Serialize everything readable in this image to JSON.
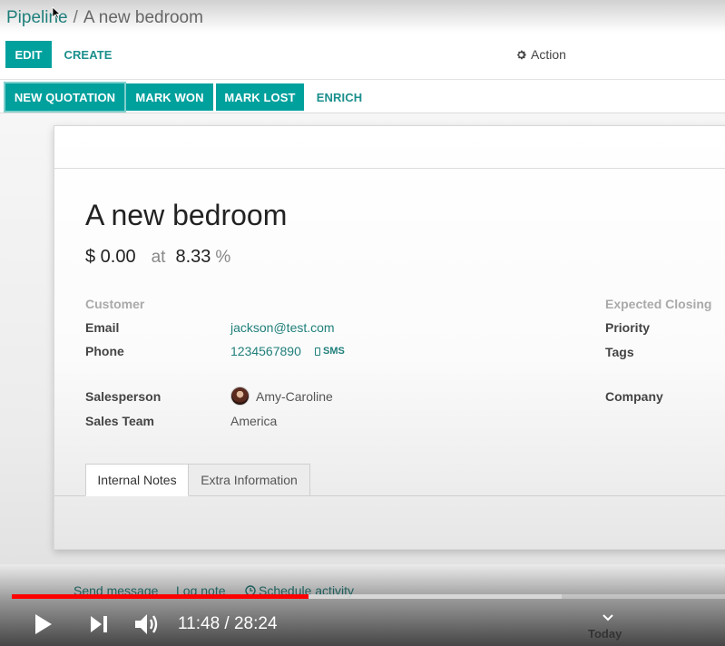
{
  "breadcrumb": {
    "parent": "Pipeline",
    "separator": "/",
    "current": "A new bedroom"
  },
  "toolbar": {
    "edit_label": "EDIT",
    "create_label": "CREATE",
    "action_label": "Action"
  },
  "statusbar_buttons": {
    "new_quotation": "NEW QUOTATION",
    "mark_won": "MARK WON",
    "mark_lost": "MARK LOST",
    "enrich": "ENRICH"
  },
  "lead": {
    "title": "A new bedroom",
    "revenue": "$ 0.00",
    "at_label": "at",
    "probability": "8.33",
    "percent_sign": "%"
  },
  "fields": {
    "customer_label": "Customer",
    "email_label": "Email",
    "email_value": "jackson@test.com",
    "phone_label": "Phone",
    "phone_value": "1234567890",
    "sms_label": "SMS",
    "salesperson_label": "Salesperson",
    "salesperson_value": "Amy-Caroline",
    "sales_team_label": "Sales Team",
    "sales_team_value": "America",
    "expected_closing_label": "Expected Closing",
    "priority_label": "Priority",
    "tags_label": "Tags",
    "company_label": "Company"
  },
  "tabs": [
    {
      "label": "Internal Notes",
      "active": true
    },
    {
      "label": "Extra Information",
      "active": false
    }
  ],
  "chatter": {
    "send_message": "Send message",
    "log_note": "Log note",
    "schedule_activity": "Schedule activity",
    "today": "Today"
  },
  "video": {
    "current_time": "11:48",
    "separator": "/",
    "duration": "28:24",
    "time_display": "11:48 / 28:24",
    "played_fraction": 0.4155,
    "buffered_fraction": 0.7708
  },
  "colors": {
    "primary": "#00a09d",
    "link": "#1f7f7b",
    "progress": "#ff0000"
  }
}
